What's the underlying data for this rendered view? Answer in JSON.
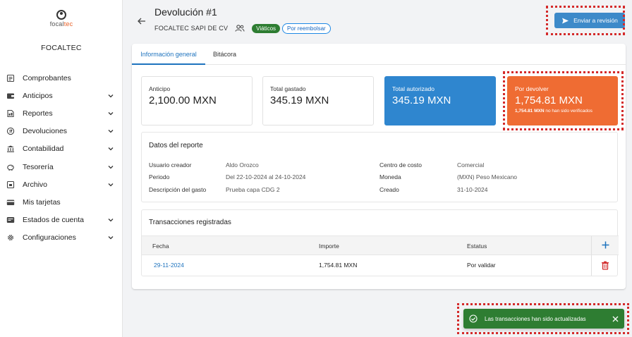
{
  "brand": {
    "logo_text_a": "focal",
    "logo_text_b": "tec",
    "company": "FOCALTEC"
  },
  "sidebar": {
    "items": [
      {
        "label": "Comprobantes",
        "icon": "receipt-icon",
        "expandable": false
      },
      {
        "label": "Anticipos",
        "icon": "wallet-icon",
        "expandable": true
      },
      {
        "label": "Reportes",
        "icon": "report-icon",
        "expandable": true
      },
      {
        "label": "Devoluciones",
        "icon": "refund-icon",
        "expandable": true
      },
      {
        "label": "Contabilidad",
        "icon": "bank-icon",
        "expandable": true
      },
      {
        "label": "Tesorería",
        "icon": "piggy-bank-icon",
        "expandable": true
      },
      {
        "label": "Archivo",
        "icon": "archive-icon",
        "expandable": true
      },
      {
        "label": "Mis tarjetas",
        "icon": "credit-card-icon",
        "expandable": false
      },
      {
        "label": "Estados de cuenta",
        "icon": "statement-icon",
        "expandable": true
      },
      {
        "label": "Configuraciones",
        "icon": "gear-icon",
        "expandable": true
      }
    ]
  },
  "header": {
    "title": "Devolución #1",
    "company": "FOCALTEC SAPI DE CV",
    "chip_type": "Viáticos",
    "chip_status": "Por reembolsar",
    "send_button": "Enviar a revisión"
  },
  "tabs": {
    "general": "Información general",
    "log": "Bitácora"
  },
  "stats": {
    "anticipo": {
      "label": "Anticipo",
      "value": "2,100.00 MXN"
    },
    "gastado": {
      "label": "Total gastado",
      "value": "345.19 MXN"
    },
    "autorizado": {
      "label": "Total autorizado",
      "value": "345.19 MXN",
      "color": "#2f86cf"
    },
    "devolver": {
      "label": "Por devolver",
      "value": "1,754.81 MXN",
      "note_bold": "1,754.81 MXN",
      "note_rest": " no han sido verificados",
      "color": "#ef6c33"
    }
  },
  "report": {
    "title": "Datos del reporte",
    "usuario_label": "Usuario creador",
    "usuario": "Aldo Orozco",
    "periodo_label": "Periodo",
    "periodo": "Del 22-10-2024 al 24-10-2024",
    "descripcion_label": "Descripción del gasto",
    "descripcion": "Prueba capa CDG 2",
    "centro_label": "Centro de costo",
    "centro": "Comercial",
    "moneda_label": "Moneda",
    "moneda": "(MXN) Peso Mexicano",
    "creado_label": "Creado",
    "creado": "31-10-2024"
  },
  "transactions": {
    "title": "Transacciones registradas",
    "columns": {
      "fecha": "Fecha",
      "importe": "Importe",
      "estatus": "Estatus"
    },
    "rows": [
      {
        "fecha": "29-11-2024",
        "importe": "1,754.81 MXN",
        "estatus": "Por validar"
      }
    ]
  },
  "toast": {
    "message": "Las transacciones han sido actualizadas",
    "color": "#2e7d32"
  }
}
